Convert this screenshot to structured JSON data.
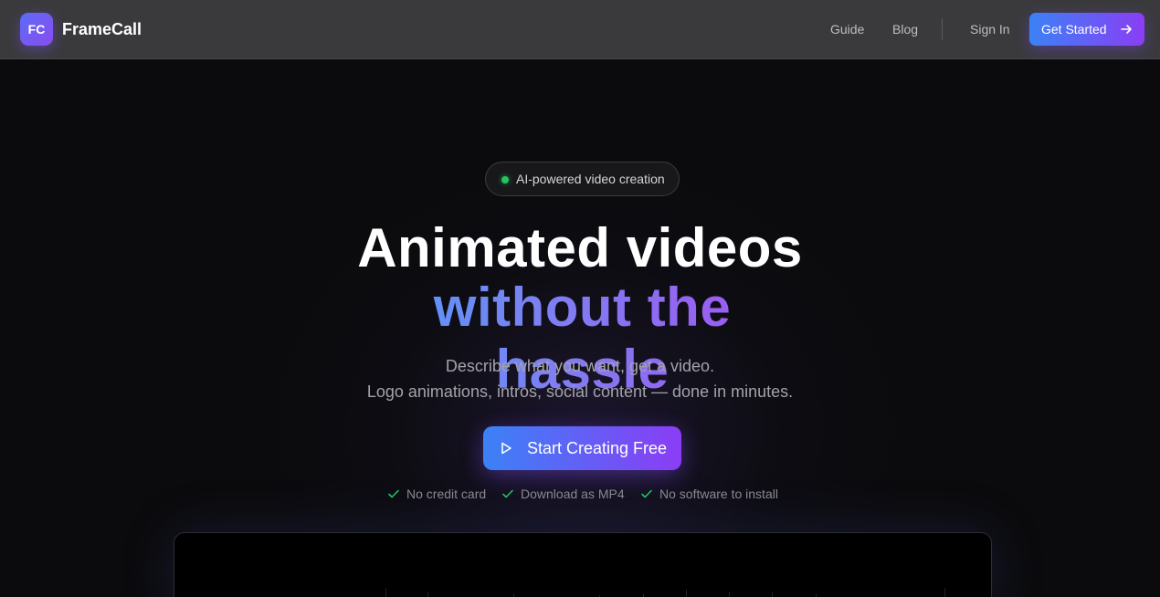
{
  "header": {
    "logo_initials": "FC",
    "brand_name": "FrameCall",
    "nav": {
      "guide": "Guide",
      "blog": "Blog",
      "sign_in": "Sign In"
    },
    "cta_label": "Get Started",
    "cta_icon": "arrow-right-icon"
  },
  "hero": {
    "badge": "AI-powered video creation",
    "badge_dot_color": "#22c55e",
    "title_line1": "Animated videos",
    "title_line2": "without the hassle",
    "subtitle_line1": "Describe what you want, get a video.",
    "subtitle_line2": "Logo animations, intros, social content — done in minutes.",
    "cta_label": "Start Creating Free",
    "cta_icon": "play-icon",
    "checks": [
      "No credit card",
      "Download as MP4",
      "No software to install"
    ]
  },
  "colors": {
    "accent_start": "#3b82f6",
    "accent_end": "#8b3df5",
    "check_green": "#22c55e"
  }
}
